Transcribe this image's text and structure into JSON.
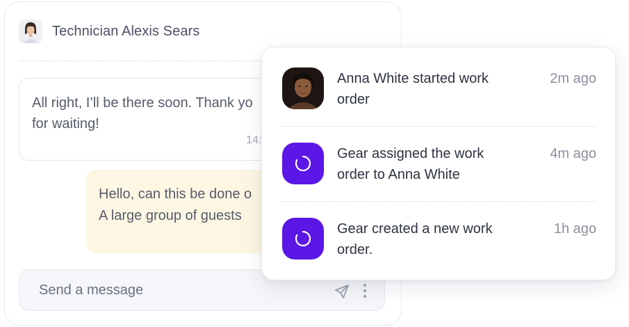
{
  "chat": {
    "title": "Technician Alexis Sears",
    "messages": [
      {
        "lines": [
          "All right, I’ll be there soon. Thank yo",
          "for waiting!"
        ],
        "time": "14:"
      },
      {
        "lines": [
          "Hello, can this be done o",
          "A large group of guests"
        ]
      }
    ],
    "composer": {
      "placeholder": "Send a message"
    }
  },
  "activity": {
    "items": [
      {
        "text": "Anna White started work order",
        "time": "2m ago",
        "icon": "avatar"
      },
      {
        "text": "Gear assigned the work order to Anna White",
        "time": "4m ago",
        "icon": "gear-spinner-icon"
      },
      {
        "text": "Gear created a new work order.",
        "time": "1h ago",
        "icon": "gear-spinner-icon"
      }
    ]
  },
  "colors": {
    "accent": "#5b17e6",
    "outgoing_bubble": "#fdf6e3",
    "border": "#e6e8ee",
    "muted_text": "#8a8f9c"
  }
}
